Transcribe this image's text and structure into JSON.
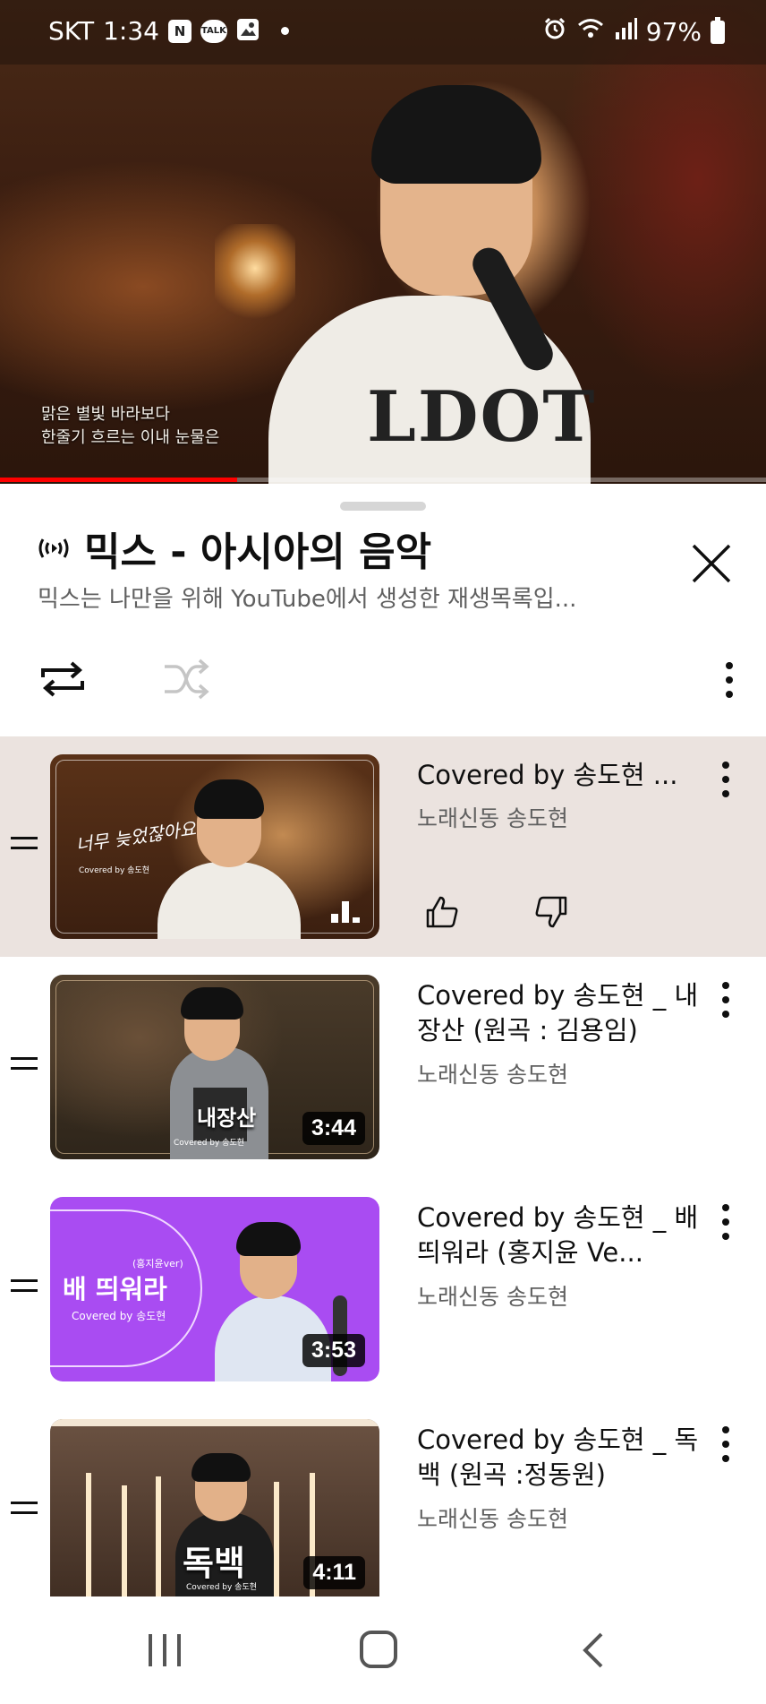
{
  "status_bar": {
    "carrier": "SKT",
    "time": "1:34",
    "notif_icons": [
      "N",
      "TALK",
      "image-icon"
    ],
    "battery": "97%"
  },
  "player": {
    "lyrics": [
      "맑은 별빛 바라보다",
      "한줄기 흐르는 이내 눈물은"
    ],
    "progress": 0.31,
    "shirt_print": "LDOT"
  },
  "playlist": {
    "title": "믹스 - 아시아의 음악",
    "subtitle": "믹스는 나만을 위해 YouTube에서 생성한 재생목록입...",
    "items": [
      {
        "title": "Covered by 송도현 ...",
        "channel": "노래신동 송도현",
        "thumb_text": "너무 늦었잖아요",
        "thumb_caption": "Covered by 송도현",
        "playing": true
      },
      {
        "title": "Covered by 송도현 _ 내장산 (원곡 : 김용임)",
        "channel": "노래신동 송도현",
        "thumb_text": "내장산",
        "thumb_caption": "Covered by 송도현",
        "duration": "3:44"
      },
      {
        "title": "Covered by 송도현 _ 배띄워라 (홍지윤 Ve...",
        "channel": "노래신동 송도현",
        "thumb_text": "배 띄워라",
        "thumb_sub": "(홍지윤ver)",
        "thumb_caption": "Covered by 송도현",
        "duration": "3:53"
      },
      {
        "title": "Covered by 송도현 _ 독백 (원곡 :정동원)",
        "channel": "노래신동 송도현",
        "thumb_text": "독백",
        "thumb_caption": "Covered by 송도현",
        "duration": "4:11"
      }
    ]
  },
  "colors": {
    "accent": "#ff0000",
    "playing_row": "#ebe3df",
    "purple_thumb": "#a94cf2"
  }
}
